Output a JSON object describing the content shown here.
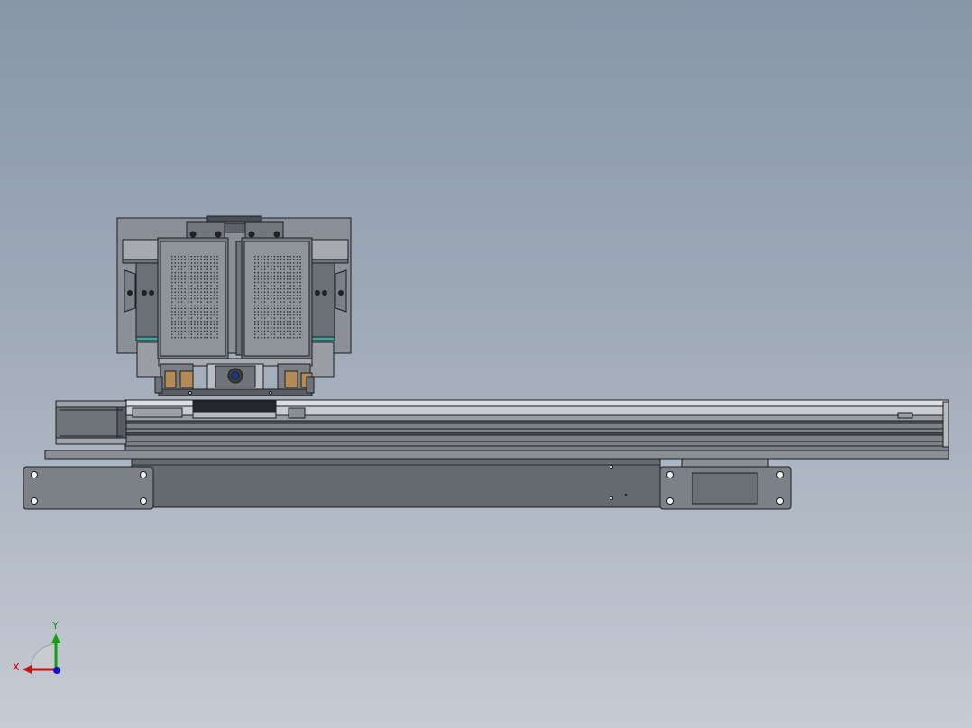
{
  "triad": {
    "x_label": "X",
    "y_label": "Y",
    "x_color": "#d01010",
    "y_color": "#10a010",
    "z_color": "#1010d0"
  },
  "colors": {
    "body": "#6b7077",
    "body_light": "#8a8f95",
    "plate": "#7b8086",
    "edge": "#1c1e22",
    "accent_teal": "#3fa5a0",
    "accent_brass": "#b48a55"
  }
}
